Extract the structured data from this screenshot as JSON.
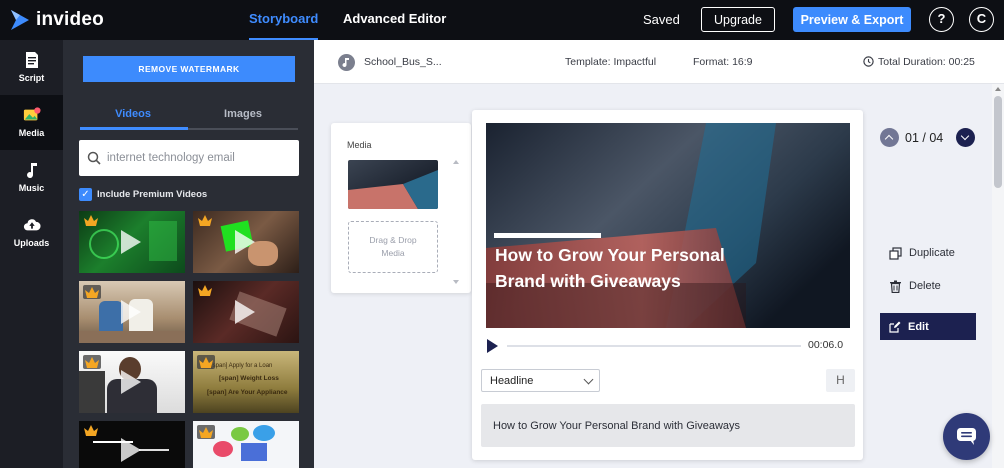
{
  "brand": {
    "name": "invideo"
  },
  "nav": {
    "storyboard": "Storyboard",
    "advanced_editor": "Advanced Editor",
    "saved": "Saved",
    "upgrade": "Upgrade",
    "preview_export": "Preview & Export",
    "help": "?",
    "avatar": "C"
  },
  "rail": [
    {
      "label": "Script",
      "icon": "document-icon"
    },
    {
      "label": "Media",
      "icon": "image-icon"
    },
    {
      "label": "Music",
      "icon": "music-note-icon"
    },
    {
      "label": "Uploads",
      "icon": "cloud-upload-icon"
    }
  ],
  "media_panel": {
    "remove_watermark": "REMOVE WATERMARK",
    "tabs": [
      "Videos",
      "Images"
    ],
    "search_placeholder": "internet technology email",
    "include_premium": "Include Premium Videos"
  },
  "info_bar": {
    "project_name": "School_Bus_S...",
    "template": "Template: Impactful",
    "format": "Format: 16:9",
    "total_duration": "Total Duration: 00:25"
  },
  "media_card": {
    "label": "Media",
    "drop_text_1": "Drag & Drop",
    "drop_text_2": "Media"
  },
  "editor": {
    "headline_line_1": "How to Grow Your Personal",
    "headline_line_2": "Brand with Giveaways",
    "time": "00:06.0",
    "style_select": "Headline",
    "h_button": "H",
    "text_value": "How to Grow Your Personal Brand with Giveaways"
  },
  "scene_nav": {
    "page": "01 / 04"
  },
  "actions": {
    "duplicate": "Duplicate",
    "delete": "Delete",
    "edit": "Edit"
  },
  "colors": {
    "accent": "#3d8bfd",
    "navy": "#1c2150",
    "topbar": "#0d0f14",
    "panel": "#2a2d35"
  }
}
